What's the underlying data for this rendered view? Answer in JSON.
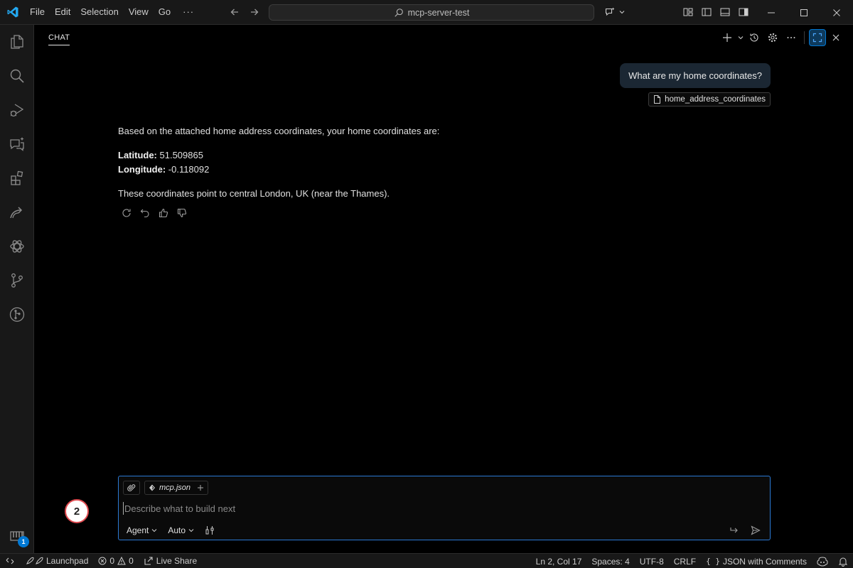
{
  "titlebar": {
    "menu": [
      "File",
      "Edit",
      "Selection",
      "View",
      "Go"
    ],
    "more": "···",
    "search_text": "mcp-server-test"
  },
  "activitybar": {
    "items": [
      "explorer",
      "search",
      "run-debug",
      "chat",
      "extensions",
      "remote-explorer",
      "openai",
      "source-control",
      "git-graph"
    ],
    "accounts_badge": "1"
  },
  "chat": {
    "tab_label": "CHAT",
    "user_message": "What are my home coordinates?",
    "attachment_name": "home_address_coordinates",
    "response": {
      "intro": "Based on the attached home address coordinates, your home coordinates are:",
      "latitude_label": "Latitude:",
      "latitude_value": " 51.509865",
      "longitude_label": "Longitude:",
      "longitude_value": " -0.118092",
      "note": "These coordinates point to central London, UK (near the Thames)."
    },
    "input": {
      "context_file": "mcp.json",
      "placeholder": "Describe what to build next",
      "mode": "Agent",
      "model": "Auto"
    },
    "step_marker": "2"
  },
  "statusbar": {
    "launchpad": "Launchpad",
    "errors": "0",
    "warnings": "0",
    "live_share": "Live Share",
    "position": "Ln 2, Col 17",
    "spaces": "Spaces: 4",
    "encoding": "UTF-8",
    "eol": "CRLF",
    "language": "JSON with Comments"
  },
  "colors": {
    "accent": "#0078d4",
    "vscode_blue": "#23a9f2",
    "input_border": "#2b79d4",
    "marker_red": "#e04b50"
  }
}
